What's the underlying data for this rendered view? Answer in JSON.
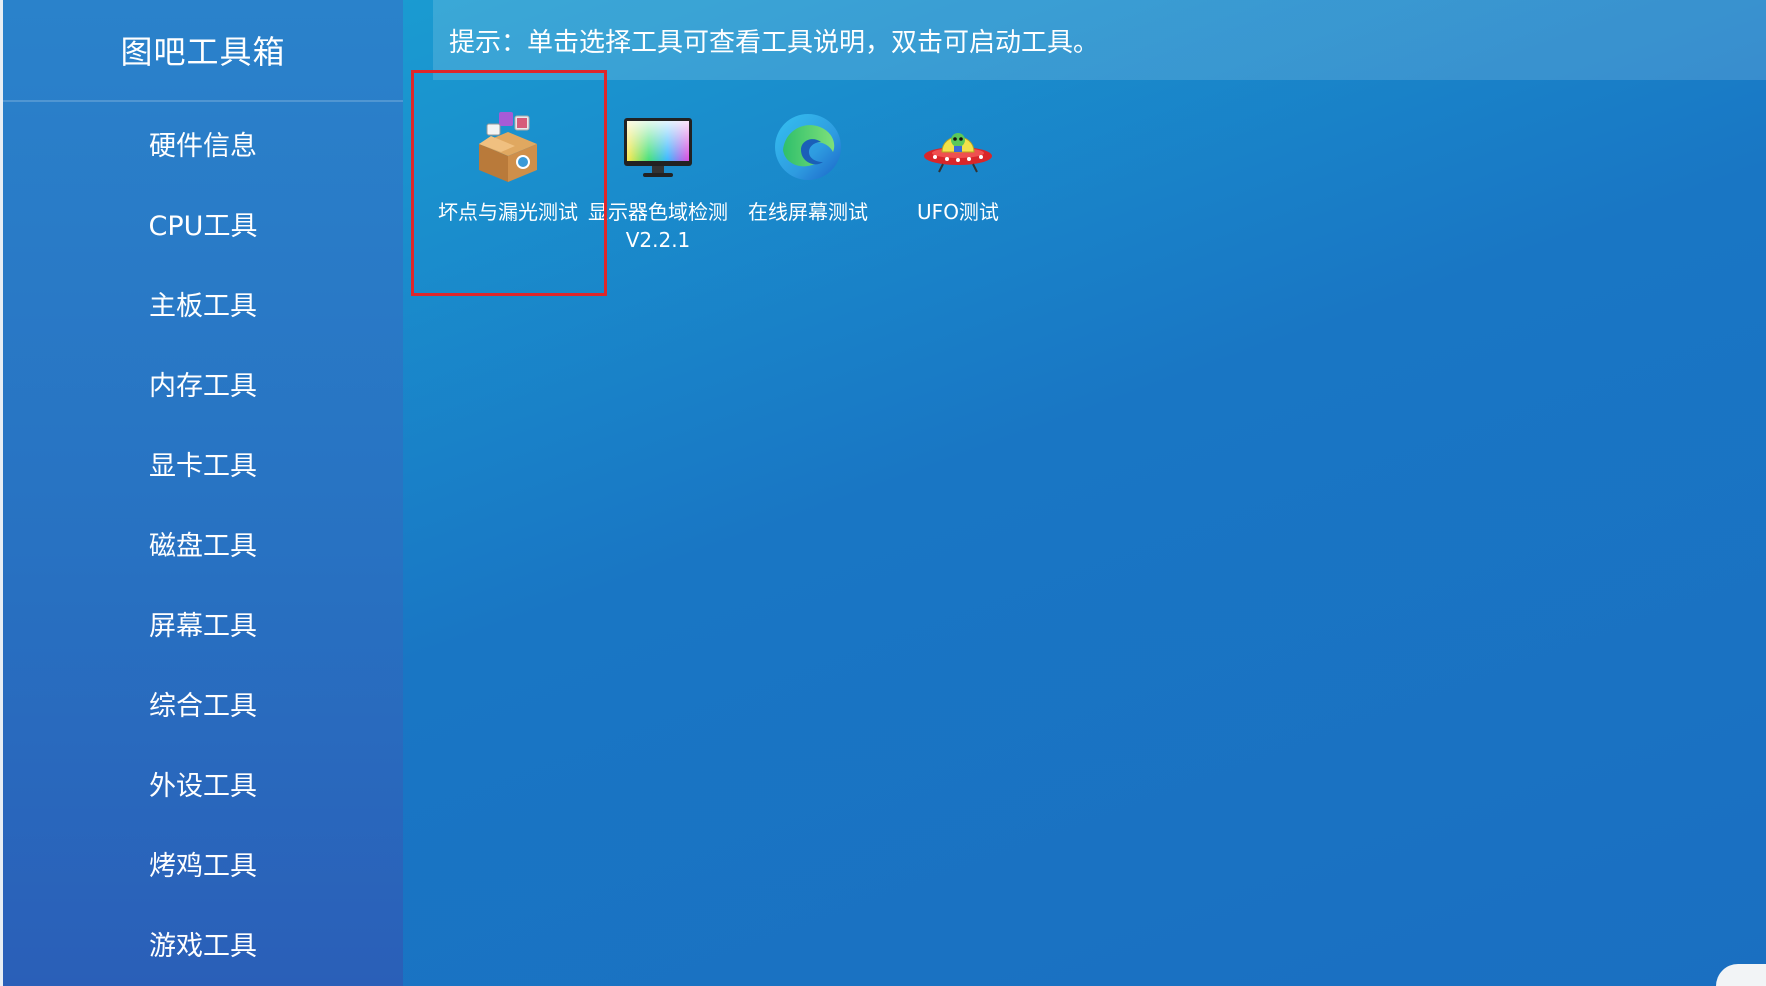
{
  "app": {
    "title": "图吧工具箱"
  },
  "sidebar": {
    "items": [
      {
        "label": "硬件信息"
      },
      {
        "label": "CPU工具"
      },
      {
        "label": "主板工具"
      },
      {
        "label": "内存工具"
      },
      {
        "label": "显卡工具"
      },
      {
        "label": "磁盘工具"
      },
      {
        "label": "屏幕工具"
      },
      {
        "label": "综合工具"
      },
      {
        "label": "外设工具"
      },
      {
        "label": "烤鸡工具"
      },
      {
        "label": "游戏工具"
      }
    ]
  },
  "tip": {
    "text": "提示：单击选择工具可查看工具说明，双击可启动工具。"
  },
  "tools": [
    {
      "label": "坏点与漏光测试",
      "icon": "package-box-icon",
      "selected": true
    },
    {
      "label": "显示器色域检测V2.2.1",
      "icon": "color-monitor-icon",
      "selected": false
    },
    {
      "label": "在线屏幕测试",
      "icon": "edge-browser-icon",
      "selected": false
    },
    {
      "label": "UFO测试",
      "icon": "ufo-icon",
      "selected": false
    }
  ],
  "colors": {
    "selection_border": "#e0262a",
    "sidebar_bg": "#2a78c6",
    "main_bg": "#1a8fd0"
  }
}
